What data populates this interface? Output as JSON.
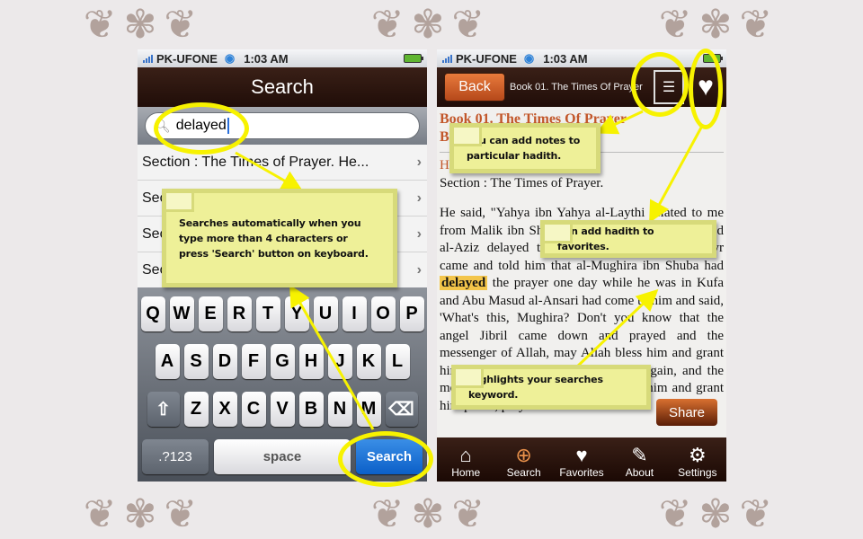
{
  "status_bar": {
    "carrier": "PK-UFONE",
    "time": "1:03 AM"
  },
  "search_screen": {
    "title": "Search",
    "search_value": "delayed",
    "results": [
      {
        "text": "Section : The Times of Prayer.   He..."
      },
      {
        "text": "Secti..."
      },
      {
        "text": "Secti..."
      },
      {
        "text": "Secti..."
      }
    ],
    "keyboard": {
      "row1": [
        "Q",
        "W",
        "E",
        "R",
        "T",
        "Y",
        "U",
        "I",
        "O",
        "P"
      ],
      "row2": [
        "A",
        "S",
        "D",
        "F",
        "G",
        "H",
        "J",
        "K",
        "L"
      ],
      "row3": [
        "Z",
        "X",
        "C",
        "V",
        "B",
        "N",
        "M"
      ],
      "num_label": ".?123",
      "space_label": "space",
      "search_label": "Search"
    }
  },
  "detail_screen": {
    "back_label": "Back",
    "nav_title": "Book 01. The Times Of Prayer",
    "book_title_line1": "Book 01. The Times Of Prayer",
    "book_title_line2": "Book 01, Number 001.",
    "hadith_label": "Hadith",
    "section": "Section : The Times of Prayer.",
    "text_before": "He said, \"Yahya ibn Yahya al-Laythi related to me from Malik ibn Shihab that one day Umar ibn Abd al-Aziz delayed the prayer. Urwa ibn az-Zubayr came and told him that al-Mughira ibn Shuba had ",
    "highlight": "delayed",
    "text_after": " the prayer one day while he was in Kufa and Abu Masud al-Ansari had come to him and said, 'What's this, Mughira? Don't you know that the angel Jibril came down and prayed and the messenger of Allah, may Allah bless him and grant him peace, prayed. Then he prayed again, and the messenger of Allah, may Allah bless him and grant him peace, prayed. Then he",
    "share_label": "Share",
    "tabs": [
      {
        "label": "Home",
        "icon": "home-icon",
        "active": false
      },
      {
        "label": "Search",
        "icon": "search-icon",
        "active": true
      },
      {
        "label": "Favorites",
        "icon": "heart-icon",
        "active": false
      },
      {
        "label": "About",
        "icon": "pencil-icon",
        "active": false
      },
      {
        "label": "Settings",
        "icon": "gear-icon",
        "active": false
      }
    ]
  },
  "annotations": {
    "search_note": "Searches automatically when you type more than 4 characters or press 'Search' button on keyboard.",
    "notes_note": "You can add notes to particular hadith.",
    "favorites_note": "Can add hadith to favorites.",
    "highlight_note": "Highlights your searches keyword."
  },
  "colors": {
    "nav_brown": "#2b140c",
    "accent_orange": "#c2572a",
    "highlight": "#f3c54a",
    "annotation_yellow": "#eef098",
    "circle_yellow": "#f7f200"
  }
}
